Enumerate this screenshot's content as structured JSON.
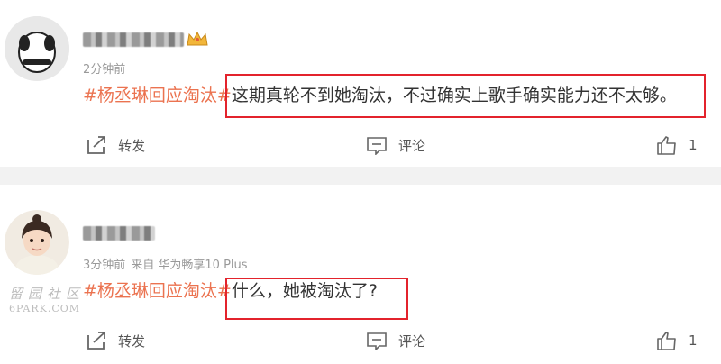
{
  "comments": [
    {
      "time": "2分钟前",
      "source": "",
      "topic": "#杨丞琳回应淘汰#",
      "text": "这期真轮不到她淘汰，不过确实上歌手确实能力还不太够。",
      "actions": {
        "repost": "转发",
        "comment": "评论",
        "like_count": "1"
      }
    },
    {
      "time": "3分钟前",
      "source": "来自 华为畅享10 Plus",
      "topic": "#杨丞琳回应淘汰#",
      "text": "什么，她被淘汰了?",
      "actions": {
        "repost": "转发",
        "comment": "评论",
        "like_count": "1"
      }
    }
  ],
  "watermark": {
    "line1": "留园社区",
    "line2": "6PARK.COM"
  },
  "colors": {
    "topic": "#eb7350",
    "highlight": "#e3232c",
    "meta": "#999999"
  }
}
